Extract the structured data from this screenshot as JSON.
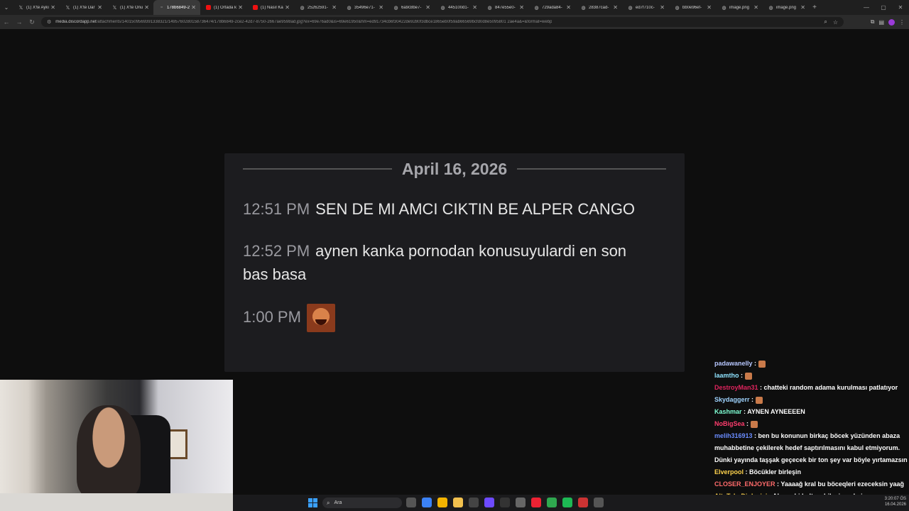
{
  "browser": {
    "tabs": [
      {
        "title": "(1) X'te Aykı",
        "icon": "x-logo-icon",
        "active": false
      },
      {
        "title": "(1) X'te Dar",
        "icon": "x-logo-icon",
        "active": false
      },
      {
        "title": "(1) X'te Onu",
        "icon": "x-logo-icon",
        "active": false
      },
      {
        "title": "178b6849-2c",
        "icon": "page-icon",
        "active": true
      },
      {
        "title": "(1) Ortada k",
        "icon": "youtube-icon",
        "active": false
      },
      {
        "title": "(1) Nasıl Ka",
        "icon": "youtube-icon",
        "active": false
      },
      {
        "title": "25262591-",
        "icon": "globe-icon",
        "active": false
      },
      {
        "title": "35496e71-",
        "icon": "globe-icon",
        "active": false
      },
      {
        "title": "6a9c8be7-",
        "icon": "globe-icon",
        "active": false
      },
      {
        "title": "445100d1-",
        "icon": "globe-icon",
        "active": false
      },
      {
        "title": "847e55e0-",
        "icon": "globe-icon",
        "active": false
      },
      {
        "title": "729ada84-",
        "icon": "globe-icon",
        "active": false
      },
      {
        "title": "28387cad-",
        "icon": "globe-icon",
        "active": false
      },
      {
        "title": "ed7f710c-",
        "icon": "globe-icon",
        "active": false
      },
      {
        "title": "bb0e96ef-",
        "icon": "globe-icon",
        "active": false
      },
      {
        "title": "image.png",
        "icon": "globe-icon",
        "active": false
      },
      {
        "title": "image.png",
        "icon": "globe-icon",
        "active": false
      }
    ],
    "url_domain": "media.discordapp.net",
    "url_path": "/attachments/1401509569391338321/1495760280158736474/178b6849-2ce2-42d7-8750-2667ae9598ad.jpg?ex=69e76ad0&is=69e61950&hm=ed91734cb6f30422de9280f3dbce1865eb0f59ab66569bcfd0d8e5095801 2ae4a&=&format=webp"
  },
  "discord": {
    "date": "April 16, 2026",
    "messages": [
      {
        "time": "12:51 PM",
        "text": "SEN DE MI AMCI CIKTIN BE ALPER CANGO"
      },
      {
        "time": "12:52 PM",
        "text": "aynen kanka pornodan konusuyulardi en son",
        "text2": "bas basa"
      },
      {
        "time": "1:00 PM",
        "text": "",
        "emoji": "laughing-face-emoji"
      }
    ]
  },
  "chat": [
    {
      "user": "padawanelly",
      "color": "#b7c7ff",
      "text": "",
      "emote": true
    },
    {
      "user": "laamtho",
      "color": "#8fe3ff",
      "text": "",
      "emote": true
    },
    {
      "user": "DestroyMan31",
      "color": "#e0245e",
      "text": "chatteki random adama kurulması patlatıyor"
    },
    {
      "user": "Skydaggerr",
      "color": "#9fd4ff",
      "text": "",
      "emote": true
    },
    {
      "user": "Kashmar",
      "color": "#7fffd4",
      "text": "AYNEN AYNEEEEN"
    },
    {
      "user": "NoBigSea",
      "color": "#ff3d6e",
      "text": "",
      "emote": true
    },
    {
      "user": "melih316913",
      "color": "#6a8cff",
      "text": "ben bu konunun birkaç böcek yüzünden abaza muhabbetine çekilerek hedef saptırılmasını kabul etmiyorum. Dünki yayında taşşak geçecek bir ton şey var böyle yırtamazsın"
    },
    {
      "user": "Elverpool",
      "color": "#ffd34d",
      "text": "Böcükler birleşin"
    },
    {
      "user": "CLOSER_ENJOYER",
      "color": "#ff6b6b",
      "text": "Yaaaağ kral bu böceqleri ezeceksin yaağ"
    },
    {
      "user": "Alt_Tab_Dinleyici",
      "color": "#ffd34d",
      "text": "Alper abi baltayı bileyip gelmiş"
    }
  ],
  "taskbar": {
    "search_placeholder": "Ara",
    "time": "3:20:07 ÖS",
    "date": "16.04.2026"
  }
}
